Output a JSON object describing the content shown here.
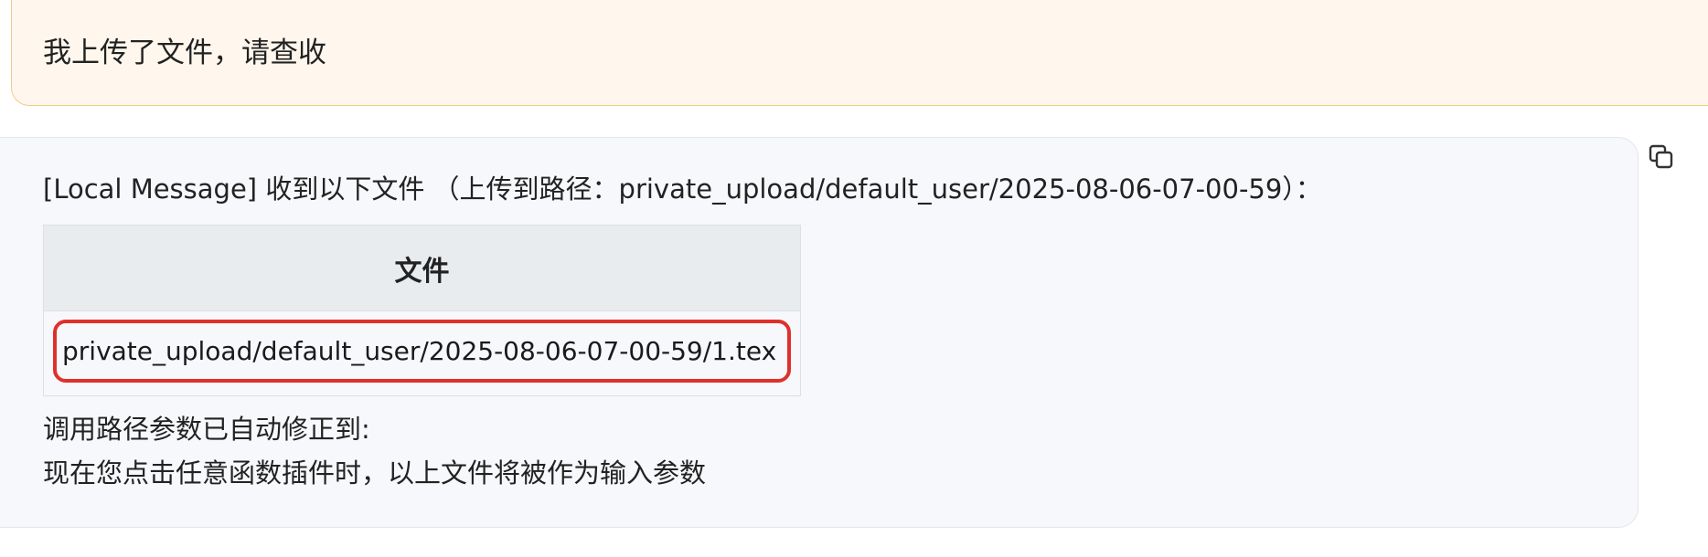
{
  "user_message": {
    "text": "我上传了文件，请查收"
  },
  "bot_message": {
    "intro": "[Local Message] 收到以下文件 （上传到路径：private_upload/default_user/2025-08-06-07-00-59）：",
    "table": {
      "header": "文件",
      "rows": [
        "private_upload/default_user/2025-08-06-07-00-59/1.tex"
      ]
    },
    "line2": "调用路径参数已自动修正到:",
    "line3": "现在您点击任意函数插件时，以上文件将被作为输入参数"
  },
  "icons": {
    "copy": "copy-icon"
  },
  "colors": {
    "user_bubble_bg": "#fff7ed",
    "user_bubble_border": "#f3c98b",
    "bot_bubble_bg": "#f6f8fb",
    "highlight": "#e0302b"
  }
}
